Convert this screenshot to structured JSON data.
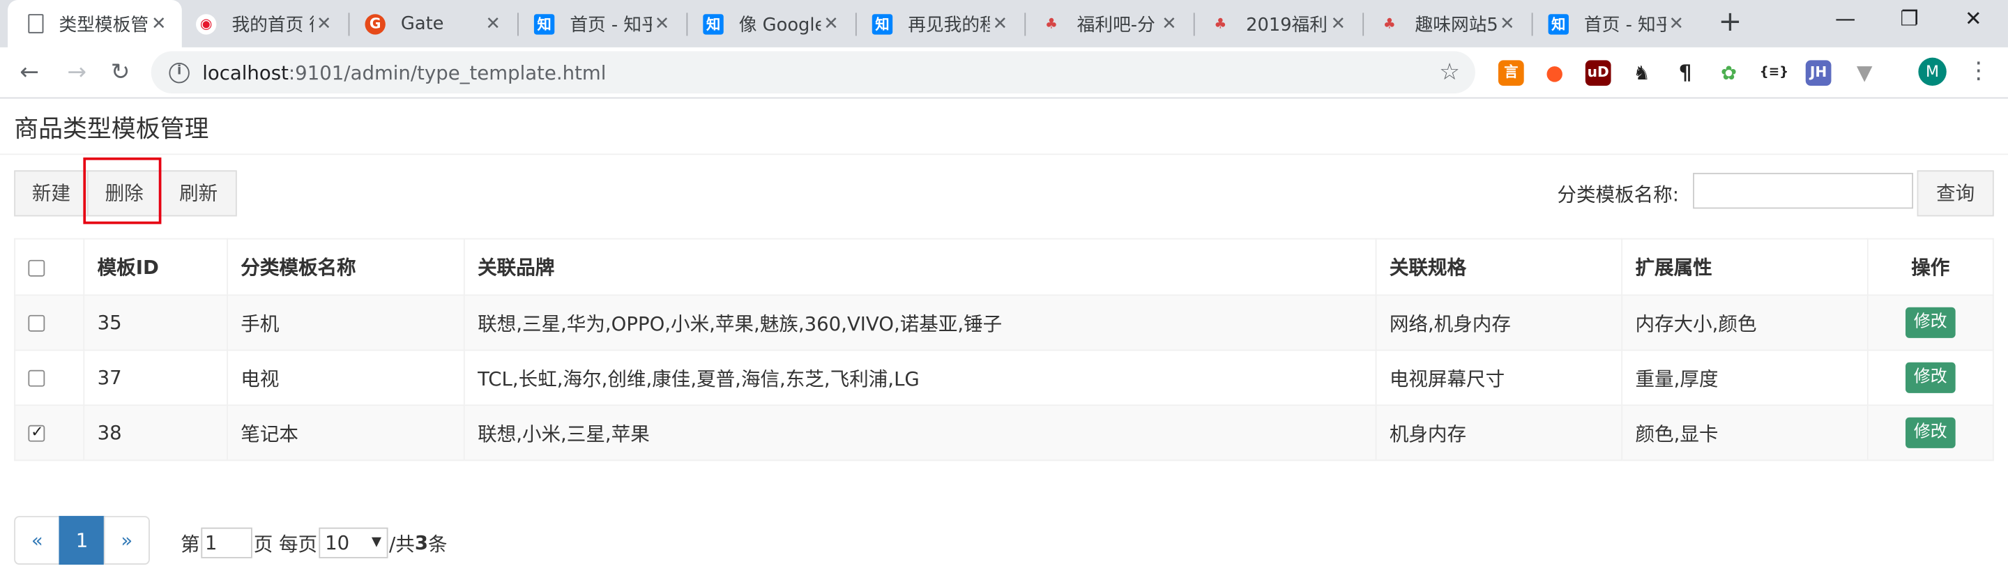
{
  "browser": {
    "tabs": [
      {
        "title": "类型模板管",
        "icon": "document-icon",
        "active": true
      },
      {
        "title": "我的首页 微",
        "icon": "weibo-icon"
      },
      {
        "title": "Gate",
        "icon": "gate-icon"
      },
      {
        "title": "首页 - 知乎",
        "icon": "zhihu-icon"
      },
      {
        "title": "像 Google",
        "icon": "zhihu-icon"
      },
      {
        "title": "再见我的程",
        "icon": "zhihu-icon"
      },
      {
        "title": "福利吧-分",
        "icon": "fuliba-icon"
      },
      {
        "title": "2019福利",
        "icon": "fuliba-icon"
      },
      {
        "title": "趣味网站5",
        "icon": "fuliba-icon"
      },
      {
        "title": "首页 - 知乎",
        "icon": "zhihu-icon"
      }
    ],
    "new_tab": "+",
    "url_host": "localhost",
    "url_rest": ":9101/admin/type_template.html",
    "avatar_letter": "M"
  },
  "page": {
    "title": "商品类型模板管理",
    "buttons": {
      "new": "新建",
      "delete": "删除",
      "refresh": "刷新",
      "query": "查询"
    },
    "search_label": "分类模板名称:",
    "search_value": ""
  },
  "table": {
    "headers": [
      "",
      "模板ID",
      "分类模板名称",
      "关联品牌",
      "关联规格",
      "扩展属性",
      "操作"
    ],
    "rows": [
      {
        "checked": false,
        "id": "35",
        "name": "手机",
        "brands": "联想,三星,华为,OPPO,小米,苹果,魅族,360,VIVO,诺基亚,锤子",
        "specs": "网络,机身内存",
        "attrs": "内存大小,颜色",
        "action": "修改"
      },
      {
        "checked": false,
        "id": "37",
        "name": "电视",
        "brands": "TCL,长虹,海尔,创维,康佳,夏普,海信,东芝,飞利浦,LG",
        "specs": "电视屏幕尺寸",
        "attrs": "重量,厚度",
        "action": "修改"
      },
      {
        "checked": true,
        "id": "38",
        "name": "笔记本",
        "brands": "联想,小米,三星,苹果",
        "specs": "机身内存",
        "attrs": "颜色,显卡",
        "action": "修改"
      }
    ]
  },
  "pagination": {
    "prev": "«",
    "current": "1",
    "next": "»",
    "label_page_prefix": "第",
    "page_input": "1",
    "label_page_suffix": "页 每页",
    "per_page": "10",
    "label_total_prefix": "/共",
    "total": "3",
    "label_total_suffix": "条"
  },
  "colors": {
    "primary": "#337ab7",
    "edit_button": "#3d9970",
    "highlight": "#e60012"
  }
}
